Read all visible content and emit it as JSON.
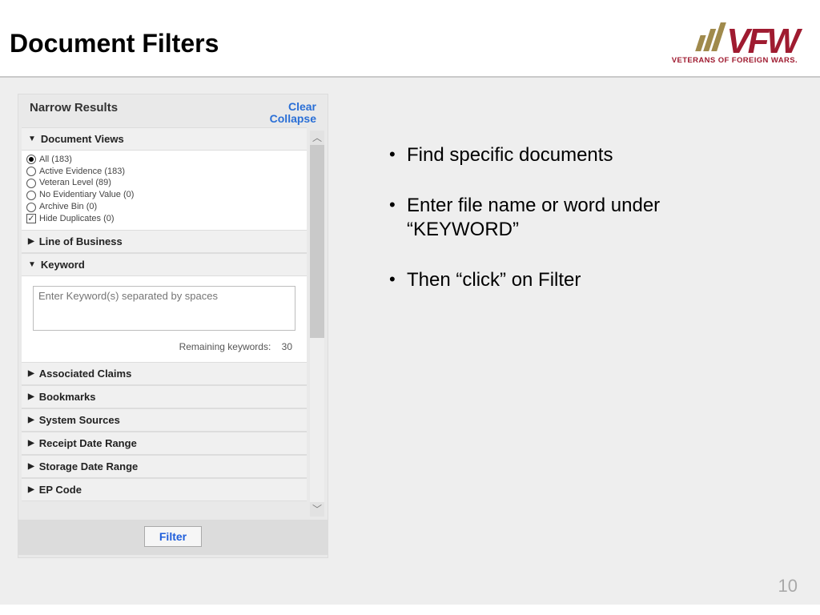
{
  "header": {
    "title": "Document Filters",
    "logo_main": "VFW",
    "logo_sub": "VETERANS OF FOREIGN WARS."
  },
  "panel": {
    "title": "Narrow Results",
    "clear": "Clear",
    "collapse": "Collapse",
    "filter_button": "Filter",
    "sections": {
      "document_views": "Document Views",
      "line_of_business": "Line of Business",
      "keyword": "Keyword",
      "associated_claims": "Associated Claims",
      "bookmarks": "Bookmarks",
      "system_sources": "System Sources",
      "receipt_date_range": "Receipt Date Range",
      "storage_date_range": "Storage Date Range",
      "ep_code": "EP Code"
    },
    "radios": {
      "all": "All (183)",
      "active_evidence": "Active Evidence (183)",
      "veteran_level": "Veteran Level (89)",
      "no_evidentiary": "No Evidentiary Value (0)",
      "archive_bin": "Archive Bin (0)"
    },
    "hide_duplicates": "Hide Duplicates (0)",
    "keyword_placeholder": "Enter Keyword(s) separated by spaces",
    "remaining_label": "Remaining keywords:",
    "remaining_value": "30"
  },
  "bullets": {
    "b1": "Find specific documents",
    "b2": "Enter file name or word under “KEYWORD”",
    "b3": "Then “click” on Filter"
  },
  "slide_number": "10"
}
